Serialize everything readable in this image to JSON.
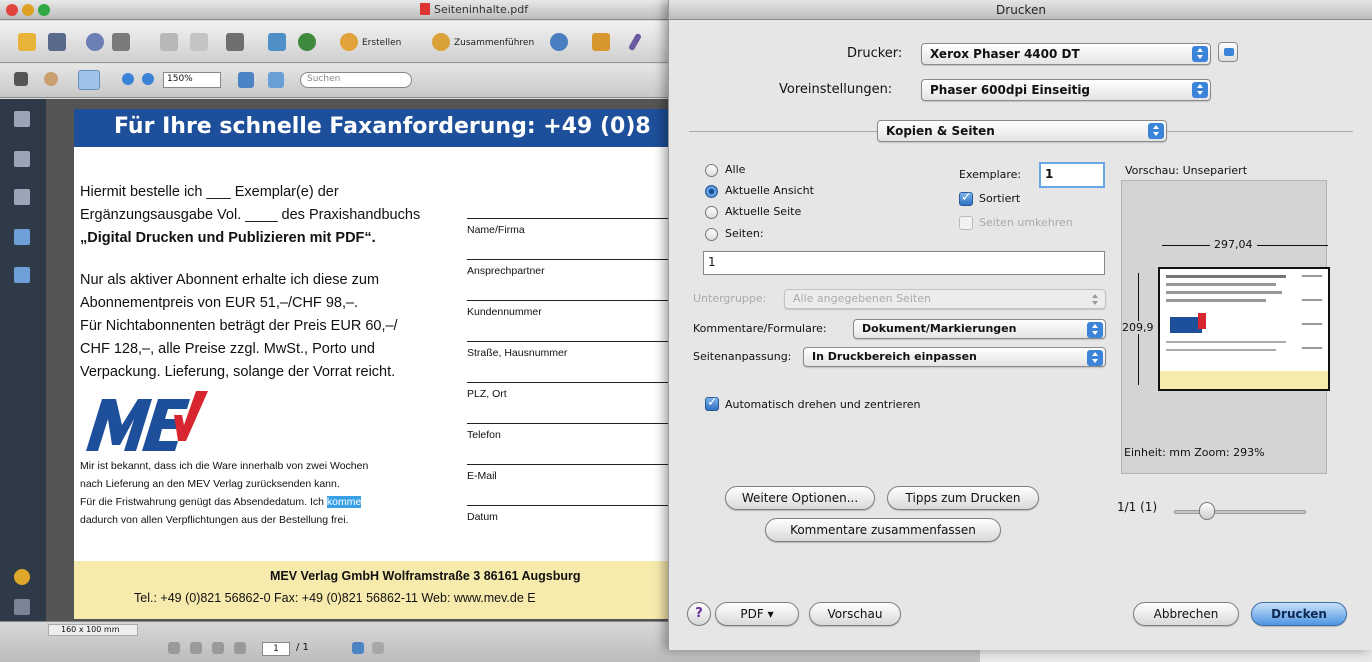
{
  "acrobat": {
    "window_title": "Seiteninhalte.pdf",
    "toolbar": {
      "create_label": "Erstellen",
      "combine_label": "Zusammenführen",
      "zoom_value": "150%",
      "search_placeholder": "Suchen"
    },
    "page": {
      "banner": "Für Ihre schnelle Faxanforderung: +49  (0)8",
      "order_lines": [
        "Hiermit bestelle ich ___ Exemplar(e) der",
        "Ergänzungsausgabe Vol. ____ des Praxishandbuchs",
        "„Digital Drucken und Publizieren mit PDF“."
      ],
      "price_lines": [
        "Nur als aktiver Abonnent erhalte ich diese zum",
        "Abonnementpreis von EUR 51,–/CHF 98,–.",
        "Für Nichtabonnenten beträgt der Preis EUR 60,–/",
        "CHF 128,–, alle Preise zzgl. MwSt., Porto und",
        "Verpackung. Lieferung, solange der Vorrat reicht."
      ],
      "logo_text": "MEV",
      "notice_lines": [
        "Mir ist bekannt, dass ich die Ware innerhalb von zwei Wochen",
        "nach Lieferung an den MEV Verlag zurücksenden kann."
      ],
      "notice_line3_pre": "Für die Fristwahrung genügt das Absendedatum. Ich ",
      "notice_line3_highlight": "komme",
      "notice_line4": "dadurch von allen Verpflichtungen aus der Bestellung frei.",
      "form_fields": [
        "Name/Firma",
        "Ansprechpartner",
        "Kundennummer",
        "Straße, Hausnummer",
        "PLZ, Ort",
        "Telefon",
        "E-Mail",
        "Datum"
      ],
      "footer_line1": "MEV Verlag GmbH   Wolframstraße 3   86161 Augsburg",
      "footer_line2": "Tel.: +49 (0)821 56862-0   Fax: +49 (0)821 56862-11   Web: www.mev.de   E"
    },
    "status": {
      "page_size": "160 x 100 mm",
      "current_page": "1",
      "page_count": "/ 1"
    }
  },
  "print_dialog": {
    "title": "Drucken",
    "printer_label": "Drucker:",
    "printer_value": "Xerox Phaser 4400 DT",
    "presets_label": "Voreinstellungen:",
    "presets_value": "Phaser 600dpi Einseitig",
    "section_value": "Kopien & Seiten",
    "range_options": [
      "Alle",
      "Aktuelle Ansicht",
      "Aktuelle Seite",
      "Seiten:"
    ],
    "selected_range": "Aktuelle Ansicht",
    "pages_value": "1",
    "copies_label": "Exemplare:",
    "copies_value": "1",
    "collate_label": "Sortiert",
    "collate_checked": true,
    "reverse_label": "Seiten umkehren",
    "reverse_checked": false,
    "subset_label": "Untergruppe:",
    "subset_value": "Alle angegebenen Seiten",
    "comments_label": "Kommentare/Formulare:",
    "comments_value": "Dokument/Markierungen",
    "scaling_label": "Seitenanpassung:",
    "scaling_value": "In Druckbereich einpassen",
    "autorotate_label": "Automatisch drehen und zentrieren",
    "autorotate_checked": true,
    "preview_title": "Vorschau: Unsepariert",
    "preview_width": "297,04",
    "preview_height": "209,9",
    "preview_info": "Einheit: mm Zoom: 293%",
    "preview_page": "1/1 (1)",
    "more_options_label": "Weitere Optionen...",
    "tips_label": "Tipps zum Drucken",
    "summarize_label": "Kommentare zusammenfassen",
    "help_label": "?",
    "pdf_label": "PDF ▾",
    "preview_button_label": "Vorschau",
    "cancel_label": "Abbrechen",
    "print_label": "Drucken",
    "accent_color": "#3b84d8"
  }
}
